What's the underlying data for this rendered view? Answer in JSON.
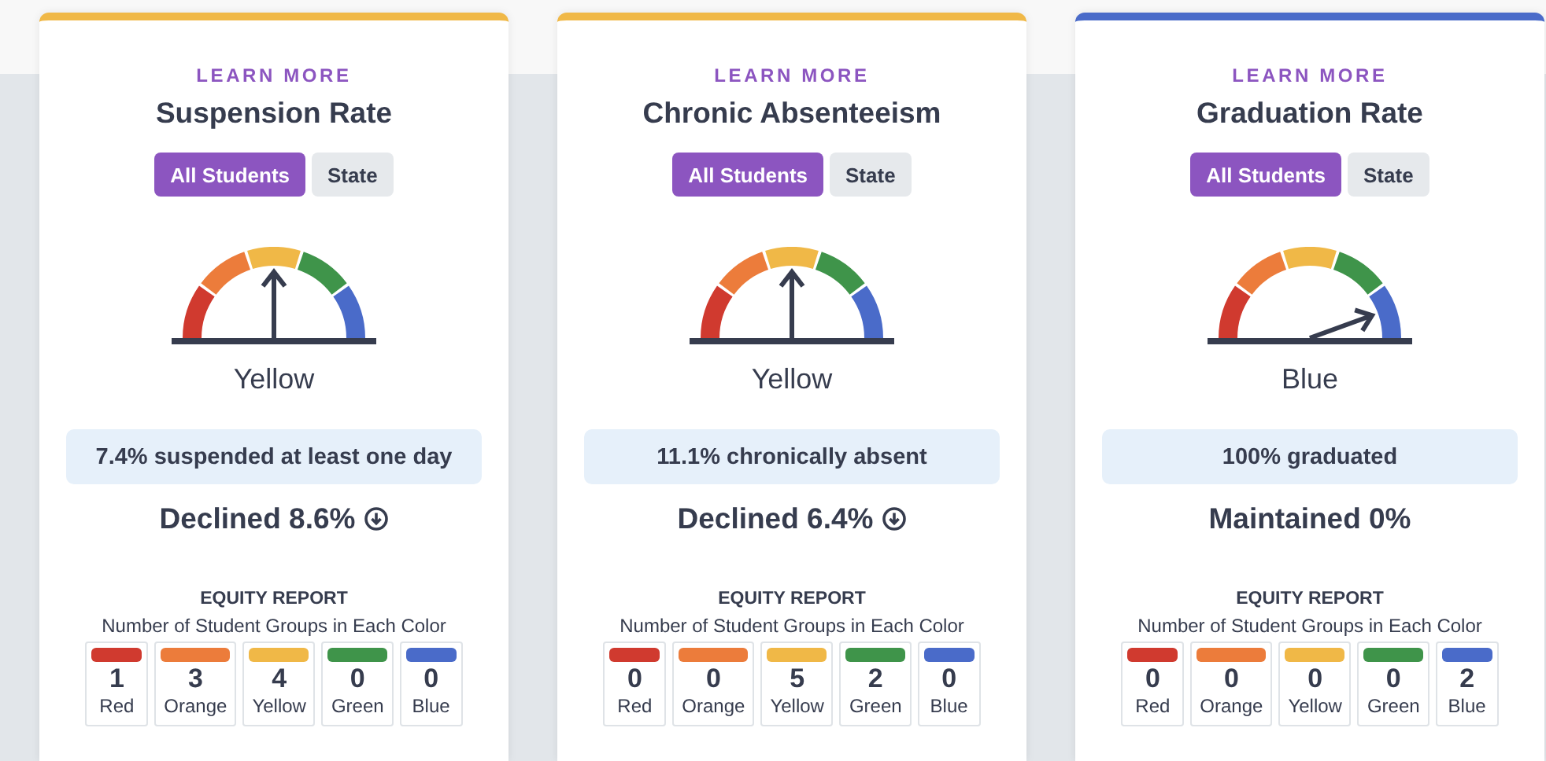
{
  "cards": [
    {
      "color": "#f0b847",
      "link": "LEARN MORE",
      "title": "Suspension Rate",
      "toggles": [
        {
          "label": "All Students",
          "selected": true
        },
        {
          "label": "State",
          "selected": false
        }
      ],
      "rating": "Yellow",
      "summary": "7.4% suspended at least one day",
      "change": "Declined 8.6%",
      "trend_down": true,
      "equity": {
        "heading": "EQUITY REPORT",
        "subtitle": "Number of Student Groups in Each Color",
        "groups": [
          {
            "count": "1",
            "label": "Red",
            "color": "#d03a2f"
          },
          {
            "count": "3",
            "label": "Orange",
            "color": "#ec7c3b"
          },
          {
            "count": "4",
            "label": "Yellow",
            "color": "#f0b847"
          },
          {
            "count": "0",
            "label": "Green",
            "color": "#3f944a"
          },
          {
            "count": "0",
            "label": "Blue",
            "color": "#4a6bc9"
          }
        ]
      }
    },
    {
      "color": "#f0b847",
      "link": "LEARN MORE",
      "title": "Chronic Absenteeism",
      "toggles": [
        {
          "label": "All Students",
          "selected": true
        },
        {
          "label": "State",
          "selected": false
        }
      ],
      "rating": "Yellow",
      "summary": "11.1% chronically absent",
      "change": "Declined 6.4%",
      "trend_down": true,
      "equity": {
        "heading": "EQUITY REPORT",
        "subtitle": "Number of Student Groups in Each Color",
        "groups": [
          {
            "count": "0",
            "label": "Red",
            "color": "#d03a2f"
          },
          {
            "count": "0",
            "label": "Orange",
            "color": "#ec7c3b"
          },
          {
            "count": "5",
            "label": "Yellow",
            "color": "#f0b847"
          },
          {
            "count": "2",
            "label": "Green",
            "color": "#3f944a"
          },
          {
            "count": "0",
            "label": "Blue",
            "color": "#4a6bc9"
          }
        ]
      }
    },
    {
      "color": "#4a6bc9",
      "link": "LEARN MORE",
      "title": "Graduation Rate",
      "toggles": [
        {
          "label": "All Students",
          "selected": true
        },
        {
          "label": "State",
          "selected": false
        }
      ],
      "rating": "Blue",
      "summary": "100% graduated",
      "change": "Maintained 0%",
      "trend_down": false,
      "equity": {
        "heading": "EQUITY REPORT",
        "subtitle": "Number of Student Groups in Each Color",
        "groups": [
          {
            "count": "0",
            "label": "Red",
            "color": "#d03a2f"
          },
          {
            "count": "0",
            "label": "Orange",
            "color": "#ec7c3b"
          },
          {
            "count": "0",
            "label": "Yellow",
            "color": "#f0b847"
          },
          {
            "count": "0",
            "label": "Green",
            "color": "#3f944a"
          },
          {
            "count": "2",
            "label": "Blue",
            "color": "#4a6bc9"
          }
        ]
      }
    }
  ]
}
